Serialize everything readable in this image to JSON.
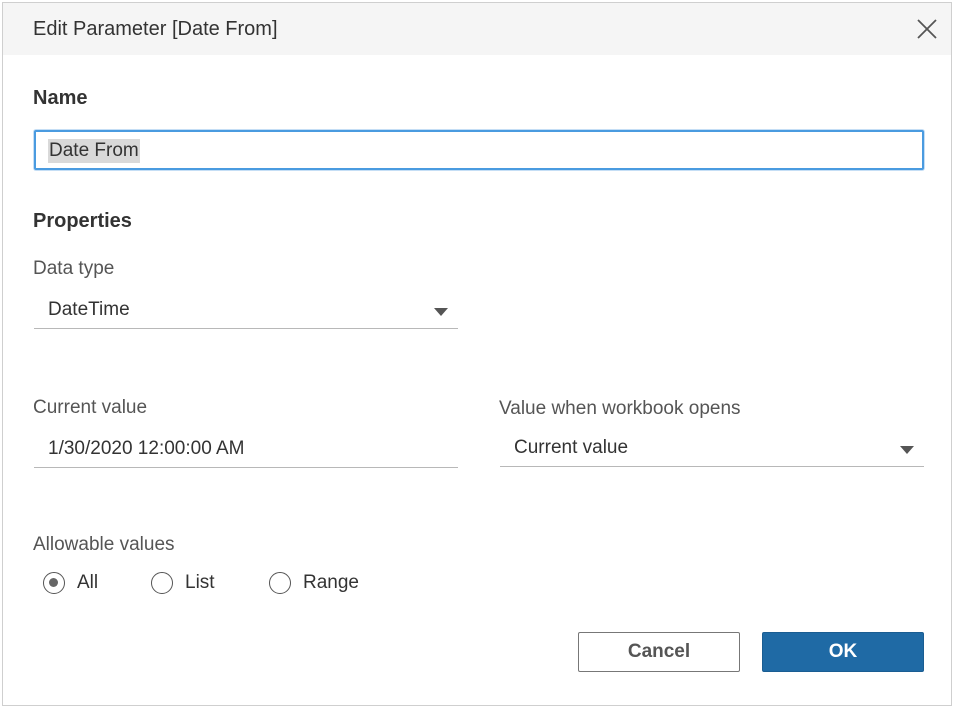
{
  "dialog": {
    "title": "Edit Parameter [Date From]",
    "close_icon": "close-icon"
  },
  "name": {
    "label": "Name",
    "value": "Date From"
  },
  "properties": {
    "label": "Properties",
    "data_type_label": "Data type",
    "data_type_value": "DateTime",
    "current_value_label": "Current value",
    "current_value": "1/30/2020 12:00:00 AM",
    "workbook_opens_label": "Value when workbook opens",
    "workbook_opens_value": "Current value"
  },
  "allowable": {
    "label": "Allowable values",
    "options": [
      "All",
      "List",
      "Range"
    ],
    "selected": "All"
  },
  "buttons": {
    "cancel": "Cancel",
    "ok": "OK"
  },
  "colors": {
    "accent": "#1f6aa5",
    "focus_border": "#4a9be0",
    "titlebar_bg": "#f5f5f5"
  }
}
